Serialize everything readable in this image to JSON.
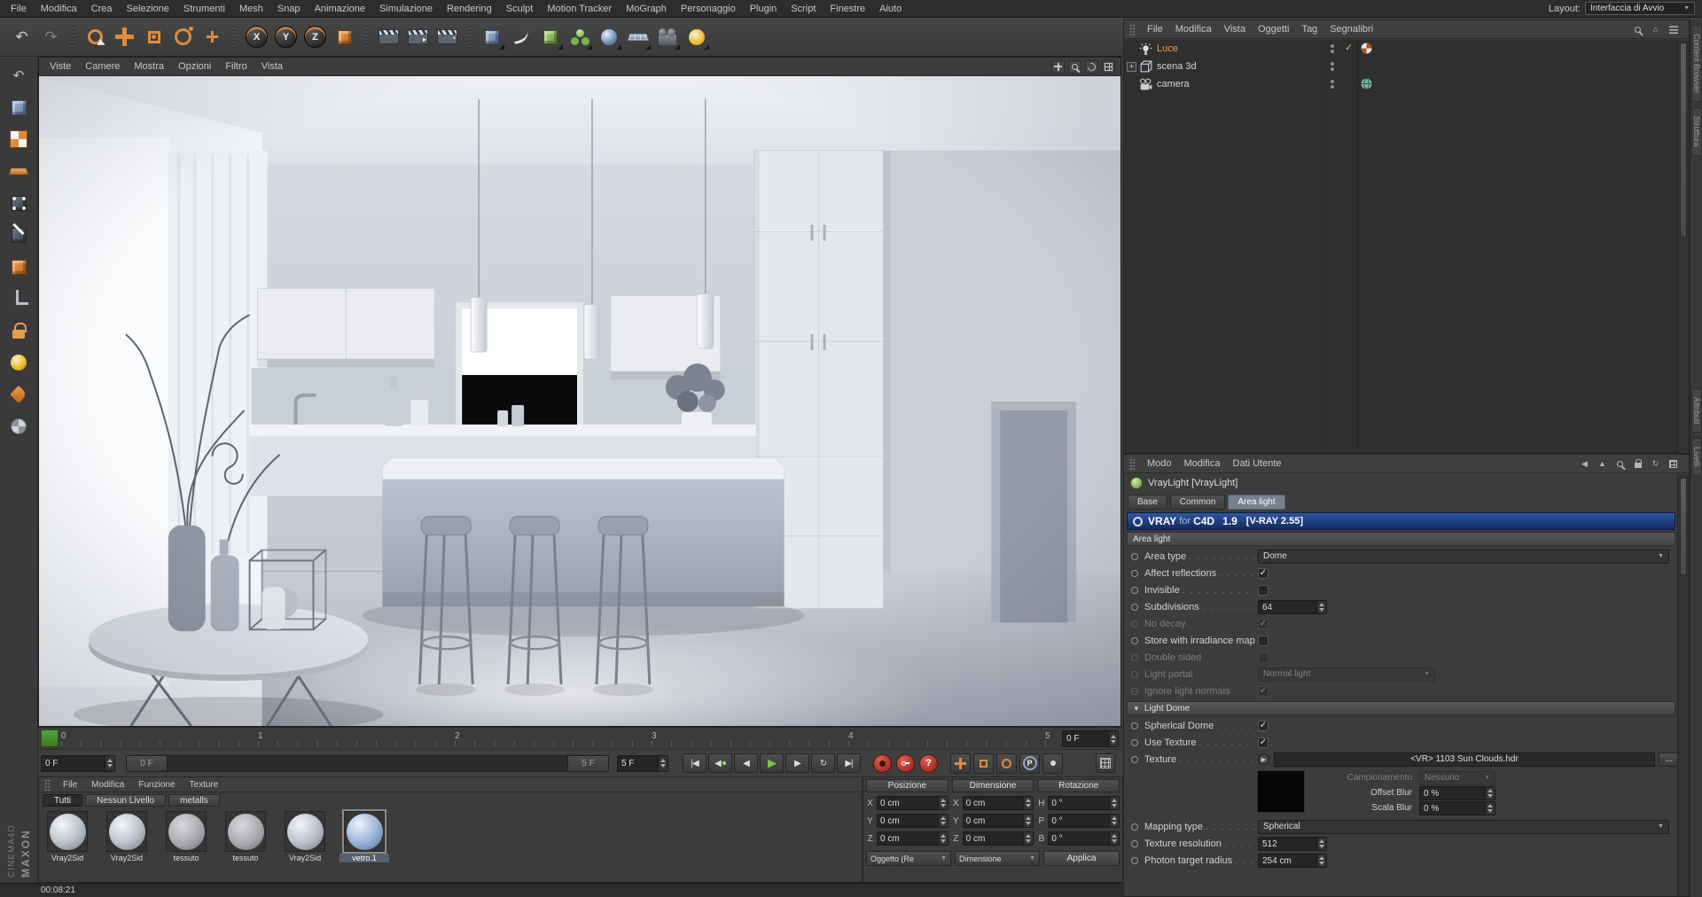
{
  "menubar": {
    "items": [
      "File",
      "Modifica",
      "Crea",
      "Selezione",
      "Strumenti",
      "Mesh",
      "Snap",
      "Animazione",
      "Simulazione",
      "Rendering",
      "Sculpt",
      "Motion Tracker",
      "MoGraph",
      "Personaggio",
      "Plugin",
      "Script",
      "Finestre",
      "Aiuto"
    ],
    "layout_label": "Layout:",
    "layout_value": "Interfaccia di Avvio"
  },
  "toolbar": {
    "tools": [
      "undo",
      "redo",
      "live-selection",
      "move",
      "scale",
      "rotate",
      "last-tool",
      "lock-x",
      "lock-y",
      "lock-z",
      "coordinate-system",
      "render-view",
      "render-picture-viewer",
      "render-settings",
      "add-cube",
      "spline-pen",
      "subdivision-surface",
      "cloner",
      "environment",
      "floor",
      "camera",
      "light"
    ],
    "axis_letters": [
      "X",
      "Y",
      "Z"
    ]
  },
  "side_toolbar": {
    "tools": [
      "make-editable",
      "model-mode",
      "texture-mode",
      "workplane-mode",
      "points-mode",
      "edges-mode",
      "polygons-mode",
      "enable-axis",
      "axis-lock",
      "sds-weight",
      "paint-tool",
      "texture-sphere"
    ]
  },
  "viewport": {
    "menu": [
      "Viste",
      "Camere",
      "Mostra",
      "Opzioni",
      "Filtro",
      "Vista"
    ],
    "view_controls": [
      "pan-view",
      "zoom-view",
      "rotate-view",
      "toggle-view"
    ]
  },
  "object_manager": {
    "menu": [
      "File",
      "Modifica",
      "Vista",
      "Oggetti",
      "Tag",
      "Segnalibri"
    ],
    "objects": [
      {
        "name": "Luce",
        "icon": "light",
        "selected": true,
        "checked": true,
        "tags": [
          "texture"
        ]
      },
      {
        "name": "scena 3d",
        "icon": "scene",
        "expandable": true
      },
      {
        "name": "camera",
        "icon": "camera",
        "tags": [
          "vray-camera"
        ]
      }
    ]
  },
  "attribute_manager": {
    "menu": [
      "Modo",
      "Modifica",
      "Dati Utente"
    ],
    "title": "VrayLight [VrayLight]",
    "tabs": [
      {
        "label": "Base",
        "active": false
      },
      {
        "label": "Common",
        "active": false
      },
      {
        "label": "Area light",
        "active": true
      }
    ],
    "banner": {
      "left": "VRAY",
      "mid": "for",
      "right": "C4D",
      "version": "1.9",
      "build": "[V-RAY 2.55]"
    },
    "section_area_light": "Area light",
    "section_light_dome": "Light Dome",
    "area_light_rows": [
      {
        "name": "area-type",
        "label": "Area type",
        "control": "select",
        "value": "Dome",
        "wide": true
      },
      {
        "name": "affect-reflections",
        "label": "Affect reflections",
        "control": "check",
        "checked": true
      },
      {
        "name": "invisible",
        "label": "Invisible",
        "control": "check",
        "checked": false
      },
      {
        "name": "subdivisions",
        "label": "Subdivisions",
        "control": "spin",
        "value": "64"
      },
      {
        "name": "no-decay",
        "label": "No decay",
        "control": "check",
        "checked": true,
        "disabled": true
      },
      {
        "name": "store-with-irradiance-map",
        "label": "Store with irradiance map",
        "control": "check",
        "checked": false
      },
      {
        "name": "double-sided",
        "label": "Double sided",
        "control": "check",
        "checked": false,
        "disabled": true
      },
      {
        "name": "light-portal",
        "label": "Light portal",
        "control": "select",
        "value": "Normal light",
        "disabled": true
      },
      {
        "name": "ignore-light-normals",
        "label": "Ignore light normals",
        "control": "check",
        "checked": true,
        "disabled": true
      }
    ],
    "light_dome_rows": [
      {
        "name": "spherical-dome",
        "label": "Spherical Dome",
        "control": "check",
        "checked": true
      },
      {
        "name": "use-texture",
        "label": "Use Texture",
        "control": "check",
        "checked": true
      },
      {
        "name": "texture",
        "label": "Texture",
        "control": "texture",
        "value": "<VR> 1103 Sun Clouds.hdr",
        "browse": "..."
      },
      {
        "name": "mapping-type",
        "label": "Mapping type",
        "control": "select",
        "value": "Spherical",
        "wide": true
      },
      {
        "name": "texture-resolution",
        "label": "Texture resolution",
        "control": "spin",
        "value": "512"
      },
      {
        "name": "photon-target-radius",
        "label": "Photon target radius",
        "control": "spin",
        "value": "254 cm"
      }
    ],
    "texture_sub_rows": [
      {
        "name": "campionamento",
        "label": "Campionamento",
        "control": "select",
        "value": "Nessuno",
        "disabled": true
      },
      {
        "name": "offset-blur",
        "label": "Offset Blur",
        "control": "spin",
        "value": "0 %"
      },
      {
        "name": "scala-blur",
        "label": "Scala Blur",
        "control": "spin",
        "value": "0 %"
      }
    ]
  },
  "timeline": {
    "ticks": [
      "0",
      "1",
      "2",
      "3",
      "4",
      "5"
    ],
    "frame_box": "0 F",
    "current_frame_field": "0 F",
    "range_start": "0 F",
    "range_end": "5 F",
    "max_frame": "5 F",
    "transport": [
      "goto-start",
      "prev-key",
      "prev-frame",
      "play",
      "next-frame",
      "loop",
      "goto-end"
    ],
    "record": [
      "record-keyframe",
      "autokeying",
      "keyframe-help"
    ],
    "help_glyph": "?",
    "parameter_letter": "P",
    "key_toggles": [
      "key-position",
      "key-scale",
      "key-rotation",
      "key-parameter",
      "key-pla"
    ]
  },
  "materials": {
    "menu": [
      "File",
      "Modifica",
      "Funzione",
      "Texture"
    ],
    "tabs": [
      {
        "label": "Tutti",
        "active": true
      },
      {
        "label": "Nessun Livello",
        "active": false
      },
      {
        "label": "metalls",
        "active": false
      }
    ],
    "items": [
      {
        "name": "Vray2Sid",
        "kind": "gray"
      },
      {
        "name": "Vray2Sid",
        "kind": "gray"
      },
      {
        "name": "tessuto",
        "kind": "fabric"
      },
      {
        "name": "tessuto",
        "kind": "fabric"
      },
      {
        "name": "Vray2Sid",
        "kind": "gray"
      },
      {
        "name": "vetro.1",
        "kind": "glass",
        "selected": true
      }
    ]
  },
  "coordinates": {
    "columns": [
      {
        "header": "Posizione",
        "rows": [
          {
            "axis": "X",
            "value": "0 cm"
          },
          {
            "axis": "Y",
            "value": "0 cm"
          },
          {
            "axis": "Z",
            "value": "0 cm"
          }
        ]
      },
      {
        "header": "Dimensione",
        "rows": [
          {
            "axis": "X",
            "value": "0 cm"
          },
          {
            "axis": "Y",
            "value": "0 cm"
          },
          {
            "axis": "Z",
            "value": "0 cm"
          }
        ]
      },
      {
        "header": "Rotazione",
        "rows": [
          {
            "axis": "H",
            "value": "0 °"
          },
          {
            "axis": "P",
            "value": "0 °"
          },
          {
            "axis": "B",
            "value": "0 °"
          }
        ]
      }
    ],
    "object_mode": "Oggetto (Re",
    "size_mode": "Dimensione",
    "apply_label": "Applica"
  },
  "status": {
    "time": "00:08:21"
  },
  "brand": {
    "maxon": "MAXON",
    "cinema": "CINEMA4D"
  },
  "right_tabs": [
    "Content Browser",
    "Struttura",
    "Attributi",
    "Livelli"
  ]
}
